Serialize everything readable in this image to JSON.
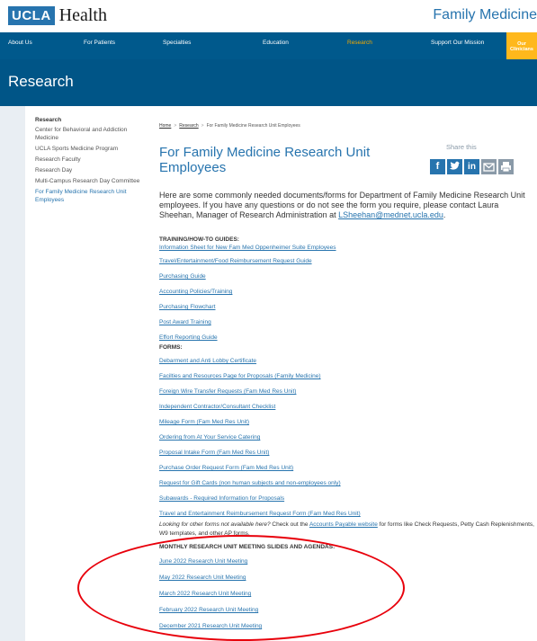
{
  "header": {
    "logo_box": "UCLA",
    "logo_text": "Health",
    "site_title": "Family Medicine"
  },
  "nav": {
    "items": [
      "About Us",
      "For Patients",
      "Specialties",
      "Education",
      "Research",
      "Support Our Mission"
    ],
    "active": "Research",
    "clinicians_line1": "Our",
    "clinicians_line2": "Clinicians"
  },
  "banner": {
    "title": "Research"
  },
  "sidebar": {
    "heading": "Research",
    "items": [
      "Center for Behavioral and Addiction Medicine",
      "UCLA Sports Medicine Program",
      "Research Faculty",
      "Research Day",
      "Multi-Campus Research Day Committee",
      "For Family Medicine Research Unit Employees"
    ]
  },
  "breadcrumb": {
    "home": "Home",
    "research": "Research",
    "current": "For Family Medicine Research Unit Employees"
  },
  "page": {
    "title": "For Family Medicine Research Unit Employees",
    "share_label": "Share this",
    "intro_text": "Here are some commonly needed documents/forms for Department of Family Medicine Research Unit employees. If you have any questions or do not see the form you require, please contact Laura Sheehan, Manager of Research Administration at ",
    "intro_email": "LSheehan@mednet.ucla.edu",
    "intro_end": "."
  },
  "share_icons": [
    "facebook-icon",
    "twitter-icon",
    "linkedin-icon",
    "email-icon",
    "print-icon"
  ],
  "training": {
    "heading": "TRAINING/HOW-TO GUIDES:",
    "links": [
      "Information Sheet for New Fam Med Oppenheimer Suite Employees",
      "Travel/Entertainment/Food Reimbursement Request Guide",
      "Purchasing Guide",
      "Accounting Policies/Training",
      "Purchasing Flowchart",
      "Post Award Training",
      "Effort Reporting Guide"
    ]
  },
  "forms": {
    "heading": "FORMS:",
    "links": [
      "Debarment and Anti Lobby Certificate",
      "Facilties and Resources Page for Proposals (Family Medicine)",
      "Foreign Wire Transfer Requests (Fam Med Res Unit)",
      "Independent Contractor/Consultant Checklist",
      "Mileage Form (Fam Med Res Unit)",
      "Ordering from At Your Service Catering",
      "Proposal Intake Form (Fam Med Res Unit)",
      "Purchase Order Request Form (Fam Med Res Unit)",
      "Request for Gift Cards (non human subjects and non-employees only)",
      "Subawards - Required Information for Proposals",
      "Travel and Entertainment Reimbursement Request Form (Fam Med Res Unit)"
    ]
  },
  "note": {
    "italic": "Looking for other forms not available here?",
    "pre": " Check out the ",
    "link": "Accounts Payable website",
    "post": " for forms like Check Requests, Petty Cash Replenishments, W9 templates, and other AP forms."
  },
  "meetings": {
    "heading": "MONTHLY RESEARCH UNIT MEETING SLIDES AND AGENDAS:",
    "links": [
      "June 2022 Research Unit Meeting",
      "May 2022 Research Unit Meeting",
      "March 2022 Research Unit Meeting",
      "February 2022 Research Unit Meeting",
      "December 2021 Research Unit Meeting"
    ]
  },
  "colors": {
    "nav_bg": "#00598c",
    "banner_bg": "#005587",
    "link": "#2774ae",
    "accent": "#ffb81c",
    "annotation": "#e8000b"
  }
}
